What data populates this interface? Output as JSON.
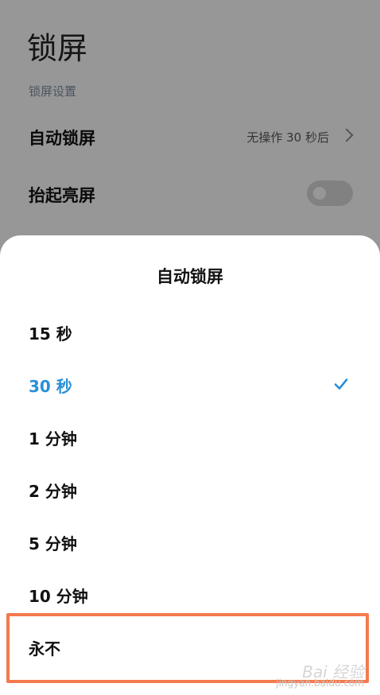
{
  "settings": {
    "title": "锁屏",
    "section_label": "锁屏设置",
    "auto_lock_label": "自动锁屏",
    "auto_lock_value": "无操作 30 秒后",
    "raise_to_wake_label": "抬起亮屏",
    "raise_to_wake_on": false
  },
  "sheet": {
    "title": "自动锁屏",
    "options": [
      {
        "label": "15 秒",
        "selected": false
      },
      {
        "label": "30 秒",
        "selected": true
      },
      {
        "label": "1 分钟",
        "selected": false
      },
      {
        "label": "2 分钟",
        "selected": false
      },
      {
        "label": "5 分钟",
        "selected": false
      },
      {
        "label": "10 分钟",
        "selected": false
      },
      {
        "label": "永不",
        "selected": false
      }
    ]
  },
  "colors": {
    "accent": "#2a8fd6",
    "highlight": "#f57a4d"
  },
  "watermark": {
    "brand": "Bai 经验",
    "url": "jingyan.baidu.com"
  }
}
